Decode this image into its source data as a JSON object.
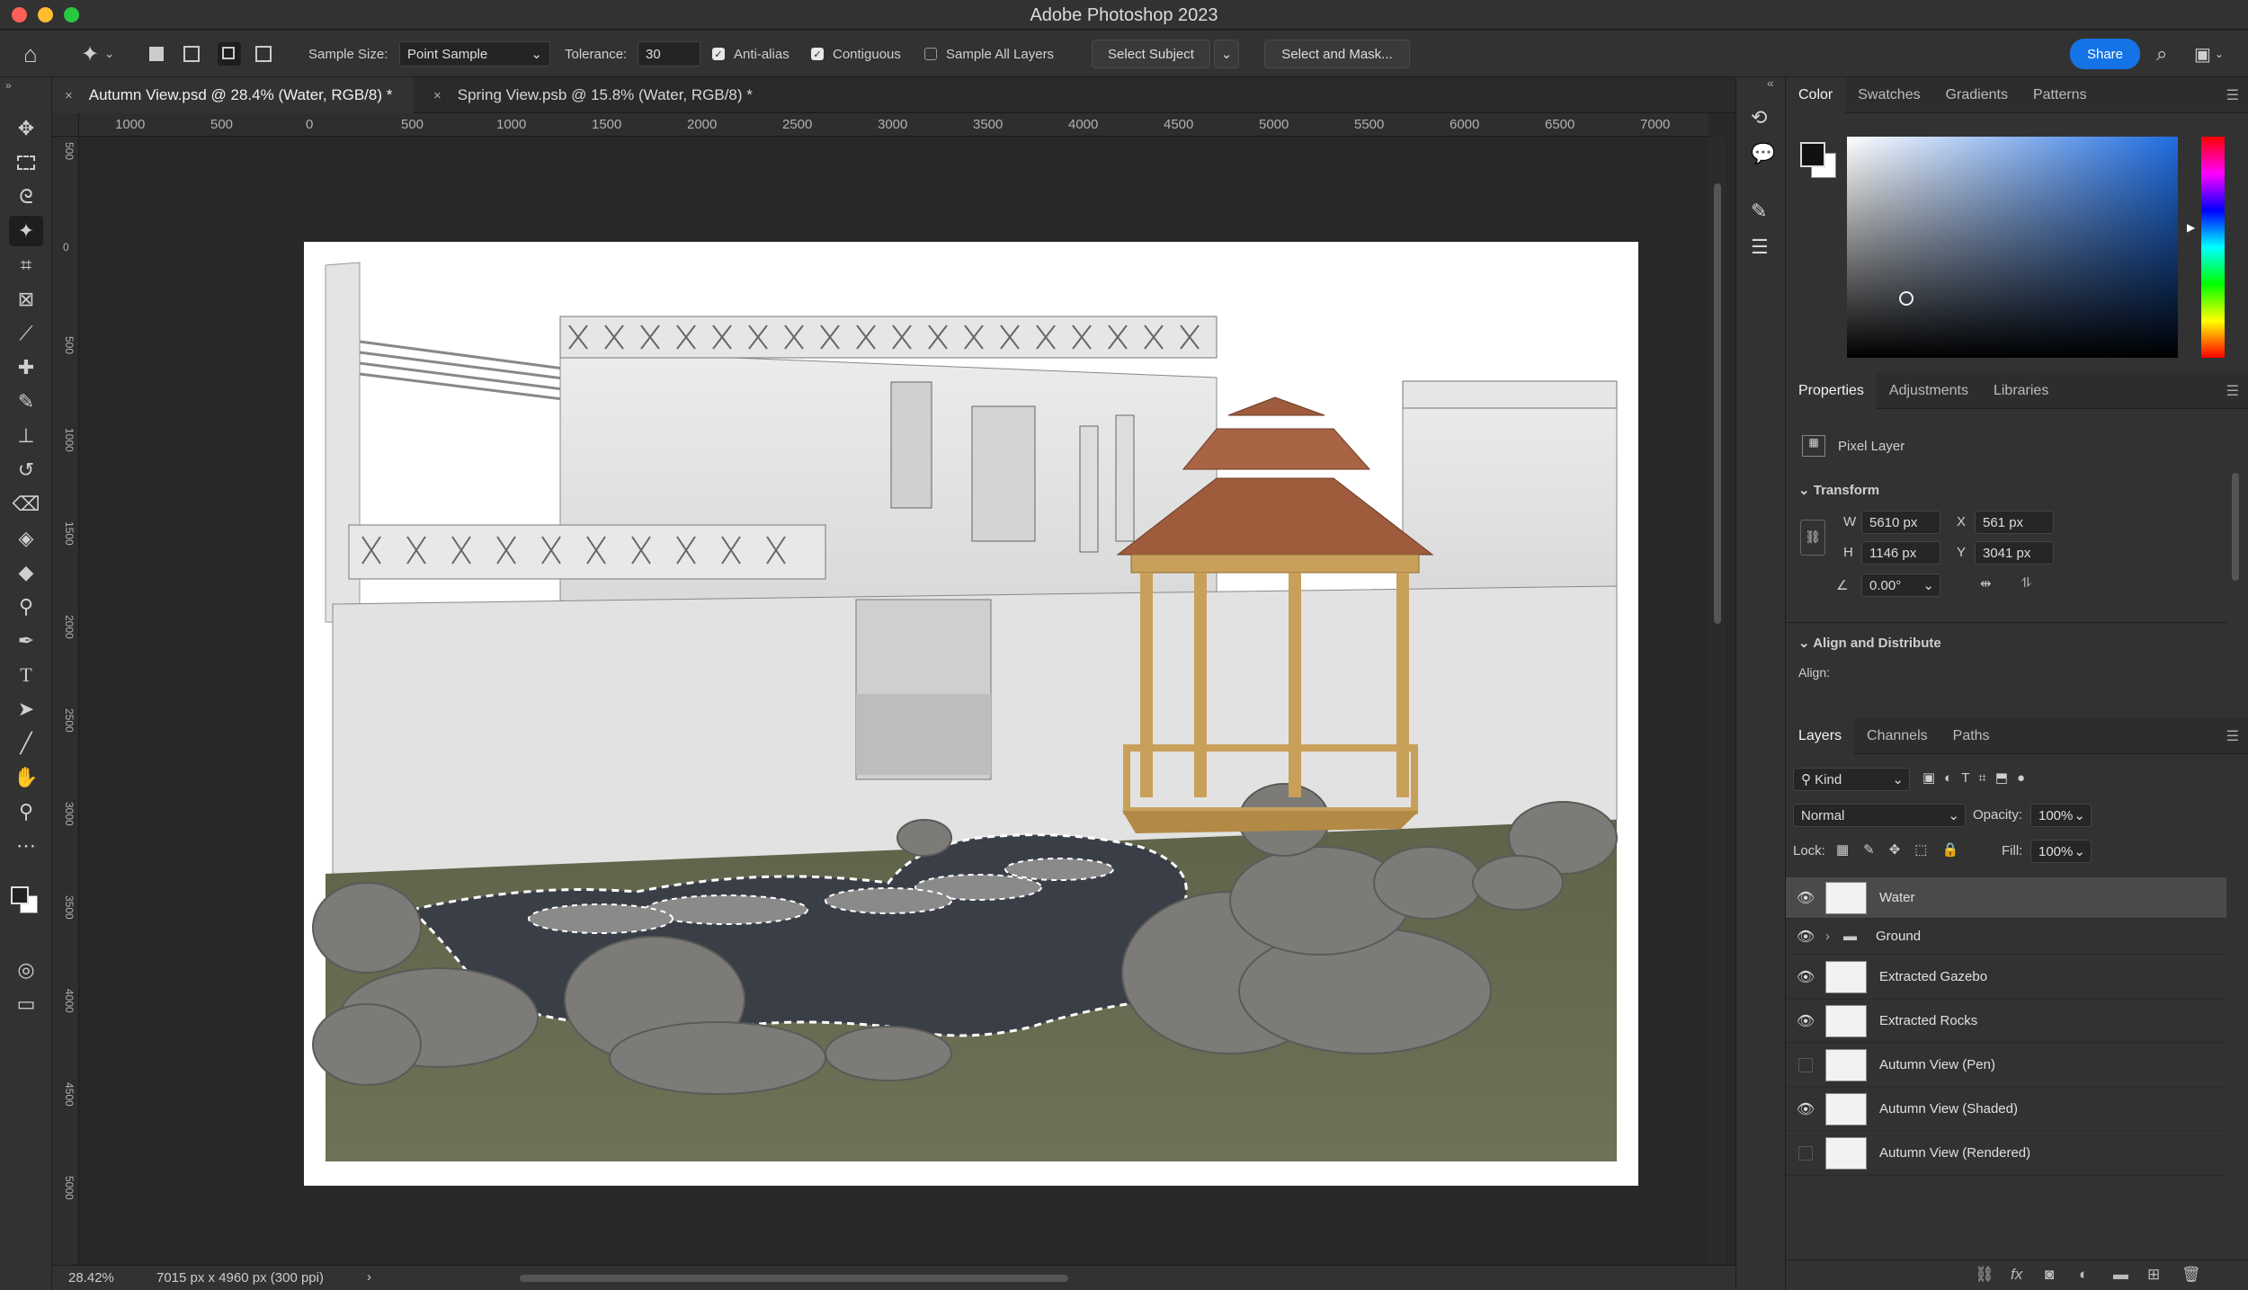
{
  "app": {
    "title": "Adobe Photoshop 2023"
  },
  "options": {
    "sample_size_label": "Sample Size:",
    "sample_size_value": "Point Sample",
    "tolerance_label": "Tolerance:",
    "tolerance_value": "30",
    "anti_alias": "Anti-alias",
    "contiguous": "Contiguous",
    "sample_all_layers": "Sample All Layers",
    "select_subject": "Select Subject",
    "select_and_mask": "Select and Mask...",
    "share": "Share"
  },
  "tabs": [
    {
      "label": "Autumn View.psd @ 28.4% (Water, RGB/8) *",
      "close": "×"
    },
    {
      "label": "Spring View.psb @ 15.8% (Water, RGB/8) *",
      "close": "×"
    }
  ],
  "ruler_h": [
    "1000",
    "500",
    "0",
    "500",
    "1000",
    "1500",
    "2000",
    "2500",
    "3000",
    "3500",
    "4000",
    "4500",
    "5000",
    "5500",
    "6000",
    "6500",
    "7000"
  ],
  "ruler_v": [
    "500",
    "0",
    "500",
    "1000",
    "1500",
    "2000",
    "2500",
    "3000",
    "3500",
    "4000",
    "4500",
    "5000"
  ],
  "status": {
    "zoom": "28.42%",
    "doc_info": "7015 px x 4960 px (300 ppi)",
    "arrow": "›"
  },
  "color_panel": {
    "tabs": [
      "Color",
      "Swatches",
      "Gradients",
      "Patterns"
    ]
  },
  "properties": {
    "tabs": [
      "Properties",
      "Adjustments",
      "Libraries"
    ],
    "layer_type": "Pixel Layer",
    "transform_label": "Transform",
    "w_label": "W",
    "w": "5610 px",
    "x_label": "X",
    "x": "561 px",
    "h_label": "H",
    "h": "1146 px",
    "y_label": "Y",
    "y": "3041 px",
    "angle": "0.00°",
    "align_label": "Align and Distribute",
    "align": "Align:"
  },
  "layers_panel": {
    "tabs": [
      "Layers",
      "Channels",
      "Paths"
    ],
    "kind": "Kind",
    "blend": "Normal",
    "opacity_label": "Opacity:",
    "opacity": "100%",
    "lock_label": "Lock:",
    "fill_label": "Fill:",
    "fill": "100%",
    "layers": [
      {
        "name": "Water",
        "visible": true,
        "selected": true
      },
      {
        "name": "Ground",
        "visible": true,
        "group": true
      },
      {
        "name": "Extracted Gazebo",
        "visible": true
      },
      {
        "name": "Extracted Rocks",
        "visible": true
      },
      {
        "name": "Autumn View (Pen)",
        "visible": false
      },
      {
        "name": "Autumn View (Shaded)",
        "visible": true
      },
      {
        "name": "Autumn View (Rendered)",
        "visible": false
      }
    ]
  },
  "colors": {
    "accent": "#1473e6",
    "panel": "#323232",
    "canvas": "#282828"
  }
}
